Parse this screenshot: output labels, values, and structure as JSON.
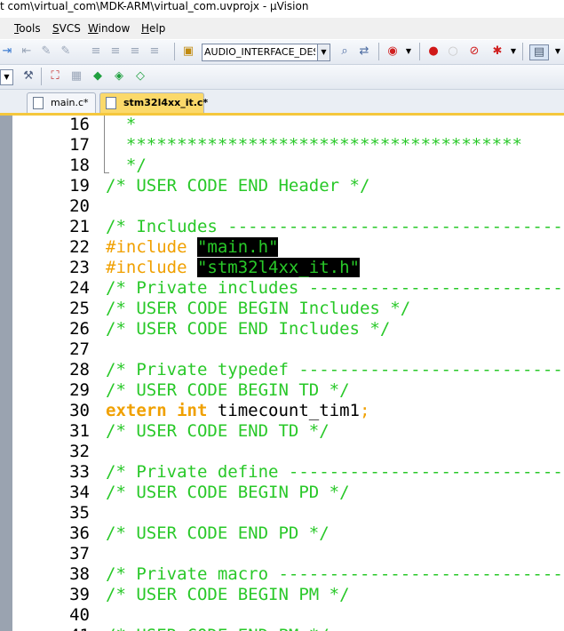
{
  "window": {
    "title": "t com\\virtual_com\\MDK-ARM\\virtual_com.uvprojx - µVision"
  },
  "menu": {
    "items": [
      {
        "label": "Tools",
        "key": "T",
        "rest": "ools"
      },
      {
        "label": "SVCS",
        "key": "S",
        "rest": "VCS"
      },
      {
        "label": "Window",
        "key": "W",
        "rest": "indow"
      },
      {
        "label": "Help",
        "key": "H",
        "rest": "elp"
      }
    ]
  },
  "toolbar": {
    "target_combo": "AUDIO_INTERFACE_DESC",
    "icons": [
      "indent-icon",
      "unindent-icon",
      "comment-icon",
      "uncomment-icon",
      "open-file-icon",
      "target-combo",
      "find-in-files-icon",
      "translate-icon",
      "debug-icon",
      "breakpoint-insert-icon",
      "breakpoint-disable-icon",
      "breakpoint-kill-icon",
      "breakpoint-manage-icon",
      "window-layout-icon"
    ]
  },
  "tabs": [
    {
      "label": "main.c*",
      "active": false
    },
    {
      "label": "stm32l4xx_it.c*",
      "active": true
    }
  ],
  "editor": {
    "lines": [
      {
        "n": "16",
        "segs": [
          [
            "c",
            "  *"
          ]
        ]
      },
      {
        "n": "17",
        "segs": [
          [
            "c",
            "  ***************************************"
          ]
        ]
      },
      {
        "n": "18",
        "segs": [
          [
            "c",
            "  */"
          ]
        ]
      },
      {
        "n": "19",
        "segs": [
          [
            "c",
            "/* USER CODE END Header */"
          ]
        ]
      },
      {
        "n": "20",
        "segs": []
      },
      {
        "n": "21",
        "segs": [
          [
            "c",
            "/* Includes ------------------------------------------"
          ]
        ]
      },
      {
        "n": "22",
        "segs": [
          [
            "pp",
            "#include "
          ],
          [
            "str",
            "\"main.h\""
          ]
        ]
      },
      {
        "n": "23",
        "segs": [
          [
            "pp",
            "#include "
          ],
          [
            "str",
            "\"stm32l4xx_it.h\""
          ]
        ]
      },
      {
        "n": "24",
        "segs": [
          [
            "c",
            "/* Private includes ----------------------------------"
          ]
        ]
      },
      {
        "n": "25",
        "segs": [
          [
            "c",
            "/* USER CODE BEGIN Includes */"
          ]
        ]
      },
      {
        "n": "26",
        "segs": [
          [
            "c",
            "/* USER CODE END Includes */"
          ]
        ]
      },
      {
        "n": "27",
        "segs": []
      },
      {
        "n": "28",
        "segs": [
          [
            "c",
            "/* Private typedef -----------------------------------"
          ]
        ]
      },
      {
        "n": "29",
        "segs": [
          [
            "c",
            "/* USER CODE BEGIN TD */"
          ]
        ]
      },
      {
        "n": "30",
        "segs": [
          [
            "kw",
            "extern int "
          ],
          [
            "plain",
            "timecount_tim1"
          ],
          [
            "punct",
            ";"
          ]
        ]
      },
      {
        "n": "31",
        "segs": [
          [
            "c",
            "/* USER CODE END TD */"
          ]
        ]
      },
      {
        "n": "32",
        "segs": []
      },
      {
        "n": "33",
        "segs": [
          [
            "c",
            "/* Private define ------------------------------------"
          ]
        ]
      },
      {
        "n": "34",
        "segs": [
          [
            "c",
            "/* USER CODE BEGIN PD */"
          ]
        ]
      },
      {
        "n": "35",
        "segs": []
      },
      {
        "n": "36",
        "segs": [
          [
            "c",
            "/* USER CODE END PD */"
          ]
        ]
      },
      {
        "n": "37",
        "segs": []
      },
      {
        "n": "38",
        "segs": [
          [
            "c",
            "/* Private macro -------------------------------------"
          ]
        ]
      },
      {
        "n": "39",
        "segs": [
          [
            "c",
            "/* USER CODE BEGIN PM */"
          ]
        ]
      },
      {
        "n": "40",
        "segs": []
      },
      {
        "n": "41",
        "segs": [
          [
            "c",
            "/* USER CODE END PM */"
          ]
        ]
      }
    ]
  },
  "colors": {
    "comment": "#28c828",
    "preprocessor": "#f0a000",
    "keyword": "#f0a000",
    "string_bg": "#000000",
    "active_tab": "#fbd96a"
  }
}
